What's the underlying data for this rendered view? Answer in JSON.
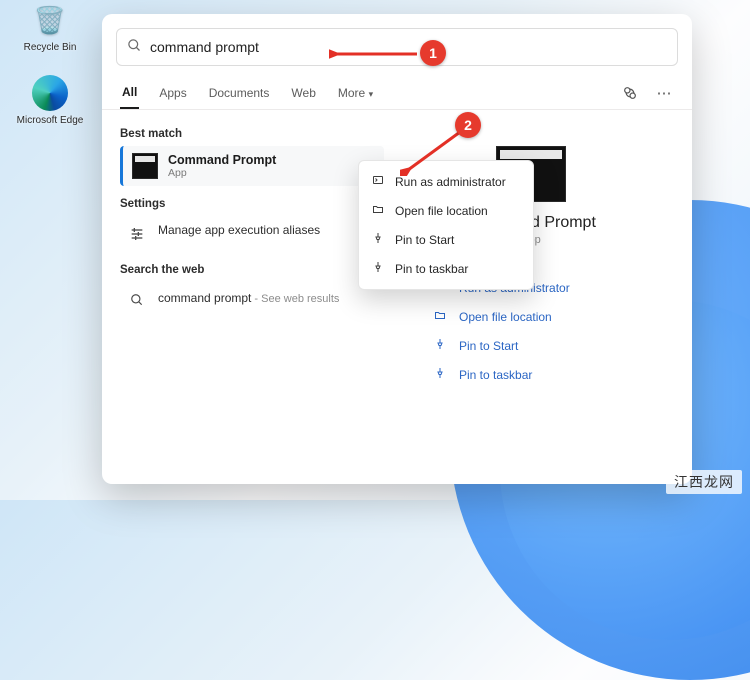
{
  "desktop": {
    "recycle_label": "Recycle Bin",
    "edge_label": "Microsoft Edge"
  },
  "search": {
    "value": "command prompt"
  },
  "tabs": {
    "all": "All",
    "apps": "Apps",
    "documents": "Documents",
    "web": "Web",
    "more": "More"
  },
  "sections": {
    "best": "Best match",
    "settings": "Settings",
    "web": "Search the web"
  },
  "best_match": {
    "title": "Command Prompt",
    "subtitle": "App"
  },
  "settings_row": {
    "text": "Manage app execution aliases"
  },
  "web_row": {
    "title": "command prompt",
    "subtitle": " - See web results"
  },
  "detail": {
    "name": "Command Prompt",
    "kind": "App"
  },
  "actions": {
    "run_admin": "Run as administrator",
    "open_loc": "Open file location",
    "pin_start": "Pin to Start",
    "pin_taskbar": "Pin to taskbar"
  },
  "context_menu": {
    "run_admin": "Run as administrator",
    "open_loc": "Open file location",
    "pin_start": "Pin to Start",
    "pin_taskbar": "Pin to taskbar"
  },
  "annotations": {
    "one": "1",
    "two": "2"
  },
  "watermark": "江西龙网"
}
